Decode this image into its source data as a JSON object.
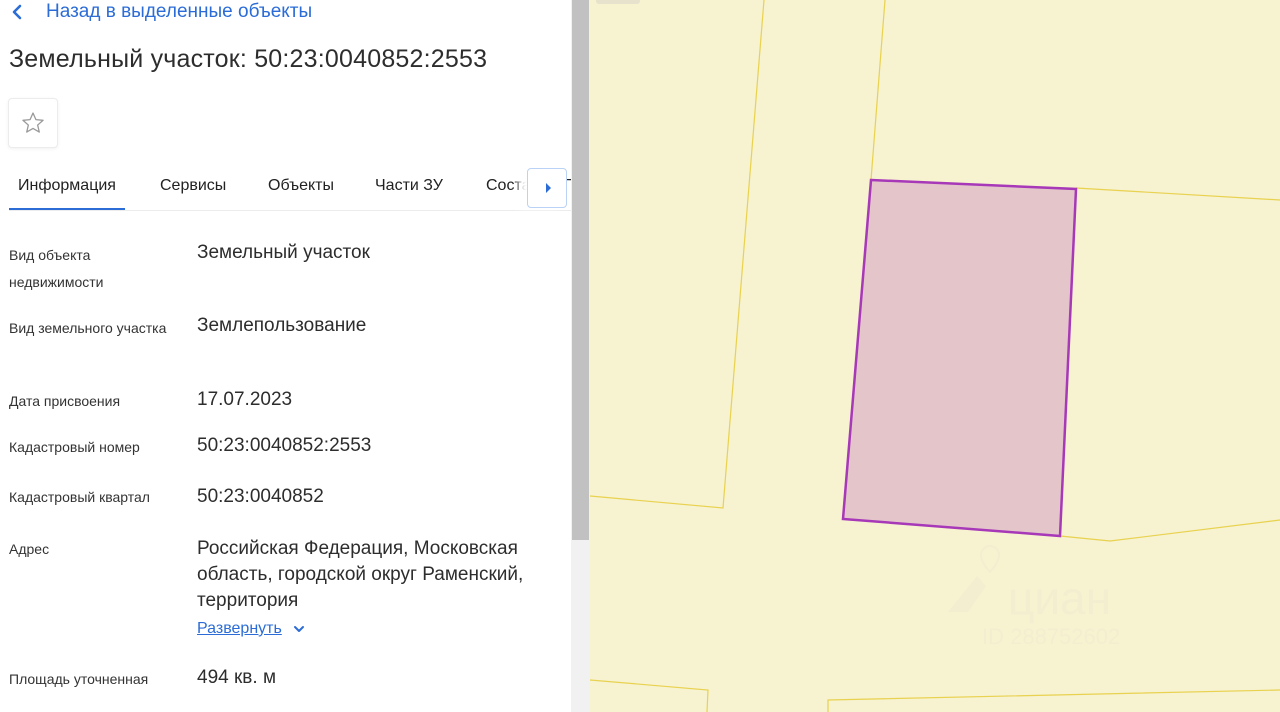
{
  "back_link": "Назад в выделенные объекты",
  "title": "Земельный участок: 50:23:0040852:2553",
  "tabs": [
    {
      "label": "Информация"
    },
    {
      "label": "Сервисы"
    },
    {
      "label": "Объекты"
    },
    {
      "label": "Части ЗУ"
    },
    {
      "label": "Состав ЕЗП"
    }
  ],
  "details": {
    "object_type": {
      "label": "Вид объекта недвижимости",
      "value": "Земельный участок"
    },
    "land_type": {
      "label": "Вид земельного участка",
      "value": "Землепользование"
    },
    "date": {
      "label": "Дата присвоения",
      "value": "17.07.2023"
    },
    "cadastral_number": {
      "label": "Кадастровый номер",
      "value": "50:23:0040852:2553"
    },
    "cadastral_block": {
      "label": "Кадастровый квартал",
      "value": "50:23:0040852"
    },
    "address": {
      "label": "Адрес",
      "value": "Российская Федерация, Московская область, городской округ Раменский, территория",
      "expand": "Развернуть"
    },
    "area": {
      "label": "Площадь уточненная",
      "value": "494 кв. м"
    }
  },
  "icons": {
    "back": "chevron-left-icon",
    "favorite": "star-outline-icon",
    "tab_scroll": "caret-right-icon",
    "expand": "chevron-down-icon",
    "watermark": "location-pin-icon"
  },
  "watermark": {
    "brand": "циан",
    "id": "ID 288752602"
  },
  "colors": {
    "accent": "#2b6cd6",
    "map_background": "#f7f2d0",
    "parcel_boundary": "#e8d24f",
    "selected_parcel_fill": "#e4c6ca",
    "selected_parcel_stroke": "#a738b8"
  }
}
